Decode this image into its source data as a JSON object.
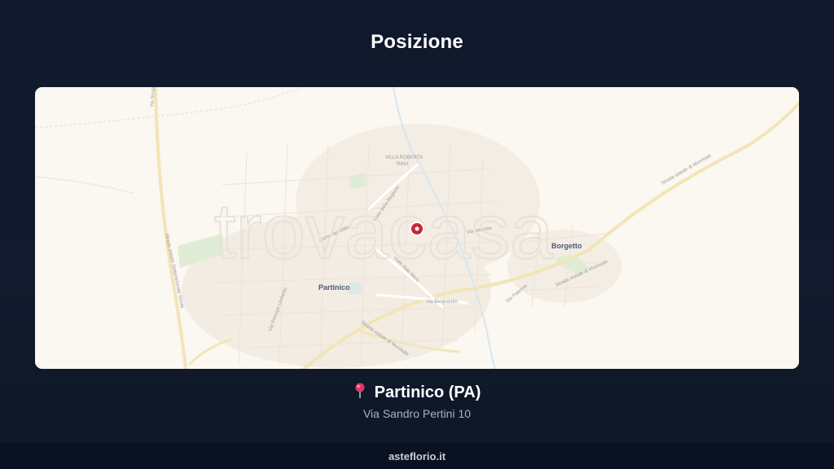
{
  "header": {
    "title": "Posizione"
  },
  "map": {
    "watermark": "trovacasa",
    "towns": {
      "main": "Partinico",
      "secondary": "Borgetto"
    },
    "poi": "VILLA ROBERTA RINA",
    "roads": [
      "Strada statale Settentrionale Sicula",
      "Viale della Regione",
      "Viale Aldo Moro",
      "Via Benevento",
      "Strada statale di Monreale",
      "Corso dei Mille",
      "Via Vecchia",
      "Via Circonvallazione",
      "Via Principe Umberto",
      "Via Palermo",
      "Via Sicula"
    ],
    "marker_icon": "map-pin-icon"
  },
  "location": {
    "icon": "pushpin-icon",
    "city": "Partinico (PA)",
    "address": "Via Sandro Pertini 10"
  },
  "footer": {
    "site": "asteflorio.it"
  },
  "colors": {
    "background": "#101a2c",
    "map_background": "#fbf7f1",
    "marker": "#c62a3a",
    "footer_bg": "#0a1120"
  }
}
